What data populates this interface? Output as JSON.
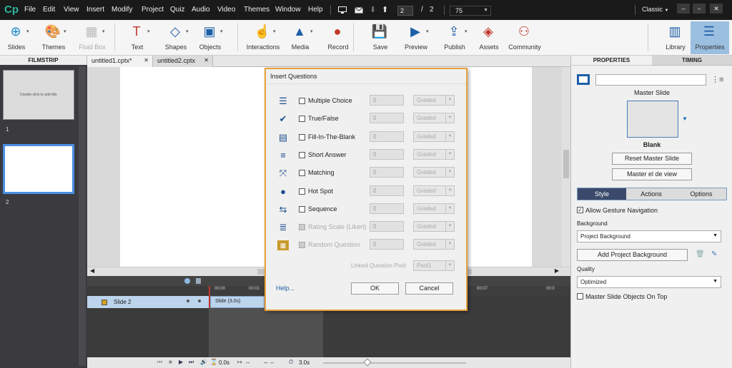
{
  "app": {
    "logo": "Cp"
  },
  "menu": [
    "File",
    "Edit",
    "View",
    "Insert",
    "Modify",
    "Project",
    "Quiz",
    "Audio",
    "Video",
    "Themes",
    "Window",
    "Help"
  ],
  "menubar_right": {
    "page_current": "2",
    "page_sep": "/",
    "page_total": "2",
    "zoom": "75",
    "workspace": "Classic",
    "min": "‒",
    "max": "▫",
    "close": "✕"
  },
  "toolbar": [
    {
      "label": "Slides",
      "icon": "slides-icon"
    },
    {
      "label": "Themes",
      "icon": "themes-icon"
    },
    {
      "label": "Fluid Box",
      "icon": "fluid-box-icon"
    },
    {
      "label": "Text",
      "icon": "text-icon"
    },
    {
      "label": "Shapes",
      "icon": "shapes-icon"
    },
    {
      "label": "Objects",
      "icon": "objects-icon"
    },
    {
      "label": "Interactions",
      "icon": "interactions-icon"
    },
    {
      "label": "Media",
      "icon": "media-icon"
    },
    {
      "label": "Record",
      "icon": "record-icon"
    },
    {
      "label": "Save",
      "icon": "save-icon"
    },
    {
      "label": "Preview",
      "icon": "preview-icon"
    },
    {
      "label": "Publish",
      "icon": "publish-icon"
    },
    {
      "label": "Assets",
      "icon": "assets-icon"
    },
    {
      "label": "Community",
      "icon": "community-icon"
    },
    {
      "label": "Library",
      "icon": "library-icon"
    },
    {
      "label": "Properties",
      "icon": "properties-icon"
    }
  ],
  "filmstrip": {
    "header": "FILMSTRIP",
    "slides": [
      {
        "thumb_text": "Double-click to add title",
        "number": "1"
      },
      {
        "thumb_text": "",
        "number": "2"
      }
    ]
  },
  "tabs": [
    {
      "label": "untitled1.cptx*",
      "close": "✕"
    },
    {
      "label": "untitled2.cptx",
      "close": "✕"
    }
  ],
  "timeline": {
    "row_label": "Slide 2",
    "bar_label": "Slide (3.0s)",
    "ruler": [
      "00:00",
      "00:01",
      "00:07",
      "00:0"
    ],
    "footer_time1": "0.0s",
    "footer_time2": "--",
    "footer_time3": "--",
    "footer_time4": "3.0s"
  },
  "dialog": {
    "title": "Insert Questions",
    "rows": [
      {
        "label": "Multiple Choice",
        "value": "0",
        "select": "Graded",
        "enabled": true,
        "icon": "multiple-choice-icon"
      },
      {
        "label": "True/False",
        "value": "0",
        "select": "Graded",
        "enabled": true,
        "icon": "true-false-icon"
      },
      {
        "label": "Fill-In-The-Blank",
        "value": "0",
        "select": "Graded",
        "enabled": true,
        "icon": "fill-blank-icon"
      },
      {
        "label": "Short Answer",
        "value": "0",
        "select": "Graded",
        "enabled": true,
        "icon": "short-answer-icon"
      },
      {
        "label": "Matching",
        "value": "0",
        "select": "Graded",
        "enabled": true,
        "icon": "matching-icon"
      },
      {
        "label": "Hot Spot",
        "value": "0",
        "select": "Graded",
        "enabled": true,
        "icon": "hot-spot-icon"
      },
      {
        "label": "Sequence",
        "value": "0",
        "select": "Graded",
        "enabled": true,
        "icon": "sequence-icon"
      },
      {
        "label": "Rating Scale (Likert)",
        "value": "0",
        "select": "Graded",
        "enabled": false,
        "icon": "rating-scale-icon"
      },
      {
        "label": "Random Question",
        "value": "0",
        "select": "Graded",
        "enabled": false,
        "icon": "random-question-icon"
      }
    ],
    "linked_label": "Linked Question Pool:",
    "linked_value": "Pool1",
    "help": "Help...",
    "ok": "OK",
    "cancel": "Cancel"
  },
  "properties": {
    "tab_properties": "PROPERTIES",
    "tab_timing": "TIMING",
    "master_slide_label": "Master Slide",
    "master_name": "Blank",
    "reset_button": "Reset Master Slide",
    "master_view_button": "Master el de view",
    "subtabs": [
      "Style",
      "Actions",
      "Options"
    ],
    "allow_gesture": "Allow Gesture Navigation",
    "background_label": "Background",
    "background_value": "Project Background",
    "add_background_button": "Add Project Background",
    "quality_label": "Quality",
    "quality_value": "Optimized",
    "master_objects_label": "Master Slide Objects On Top"
  }
}
